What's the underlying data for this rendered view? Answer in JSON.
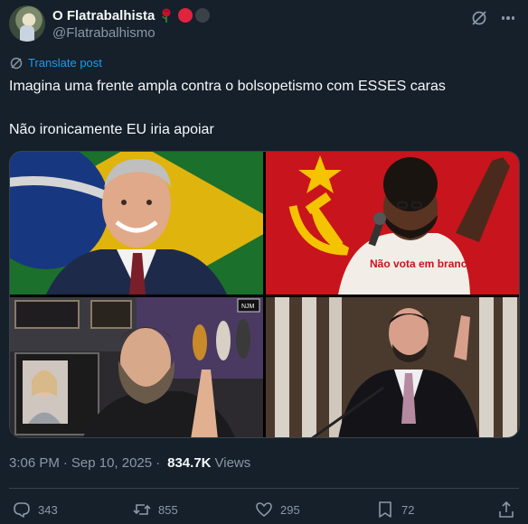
{
  "author": {
    "display_name": "O Flatrabalhista",
    "handle": "@Flatrabalhismo"
  },
  "translate_label": "Translate post",
  "post": {
    "line1": "Imagina uma frente ampla contra o bolsopetismo com ESSES caras",
    "line2": "Não ironicamente EU iria apoiar"
  },
  "media": {
    "image2_shirt_text": "Não vota em branco",
    "image3_badge": "NJM"
  },
  "meta": {
    "time": "3:06 PM",
    "separator": "·",
    "date": "Sep 10, 2025",
    "separator2": "·",
    "views_count": "834.7K",
    "views_label": "Views"
  },
  "actions": {
    "replies": "343",
    "reposts": "855",
    "likes": "295",
    "bookmarks": "72"
  },
  "colors": {
    "background": "#15202b",
    "accent": "#1d9bf0",
    "muted": "#8b98a5",
    "text": "#f7f9f9"
  }
}
